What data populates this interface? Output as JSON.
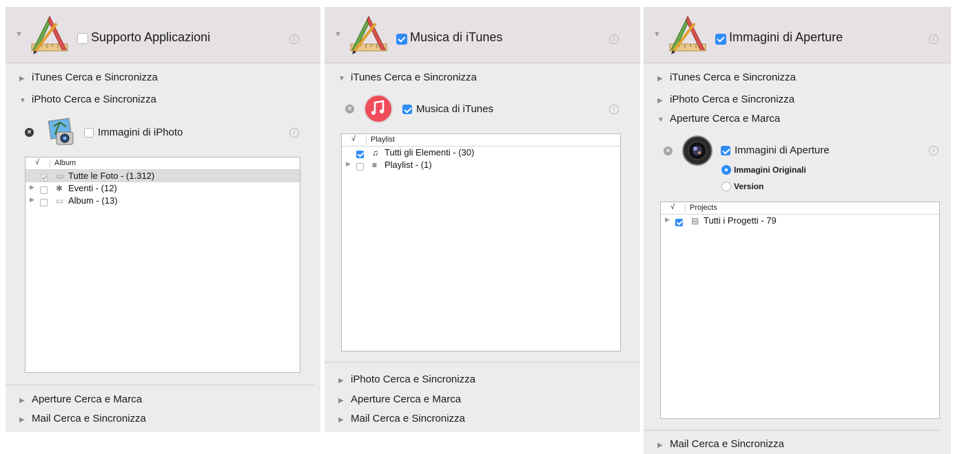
{
  "panels": [
    {
      "header_title": "Supporto Applicazioni",
      "header_checked": false,
      "sections_top": [
        "iTunes Cerca e Sincronizza",
        "iPhoto Cerca e Sincronizza"
      ],
      "source_label": "Immagini di iPhoto",
      "source_checked": false,
      "table_column": "Album",
      "rows": [
        {
          "text": "Tutte le Foto - (1.312)",
          "checked": "grey",
          "expandable": false,
          "icon": "photo-library-icon",
          "selected": true
        },
        {
          "text": "Eventi - (12)",
          "checked": false,
          "expandable": true,
          "icon": "palm-tree-icon",
          "selected": false
        },
        {
          "text": "Album - (13)",
          "checked": false,
          "expandable": true,
          "icon": "album-icon",
          "selected": false
        }
      ],
      "sections_bottom": [
        "Aperture Cerca e Marca",
        "Mail Cerca e Sincronizza"
      ]
    },
    {
      "header_title": "Musica di iTunes",
      "header_checked": true,
      "sections_top": [
        "iTunes Cerca e Sincronizza"
      ],
      "source_label": "Musica di iTunes",
      "source_checked": true,
      "table_column": "Playlist",
      "rows": [
        {
          "text": "Tutti gli Elementi - (30)",
          "checked": true,
          "expandable": false,
          "icon": "music-note-icon"
        },
        {
          "text": "Playlist - (1)",
          "checked": false,
          "expandable": true,
          "icon": "playlist-icon"
        }
      ],
      "sections_bottom": [
        "iPhoto Cerca e Sincronizza",
        "Aperture Cerca e Marca",
        "Mail Cerca e Sincronizza"
      ]
    },
    {
      "header_title": "Immagini di Aperture",
      "header_checked": true,
      "sections_top": [
        "iTunes Cerca e Sincronizza",
        "iPhoto Cerca e Sincronizza",
        "Aperture Cerca e Marca"
      ],
      "source_label": "Immagini di Aperture",
      "source_checked": true,
      "radio_options": [
        {
          "label": "Immagini Originali",
          "selected": true
        },
        {
          "label": "Version",
          "selected": false
        }
      ],
      "table_column": "Projects",
      "rows": [
        {
          "text": "Tutti i Progetti - 79",
          "checked": true,
          "expandable": true,
          "icon": "projects-icon"
        }
      ],
      "sections_bottom": [
        "Mail Cerca e Sincronizza"
      ]
    }
  ],
  "table_check_header": "√"
}
